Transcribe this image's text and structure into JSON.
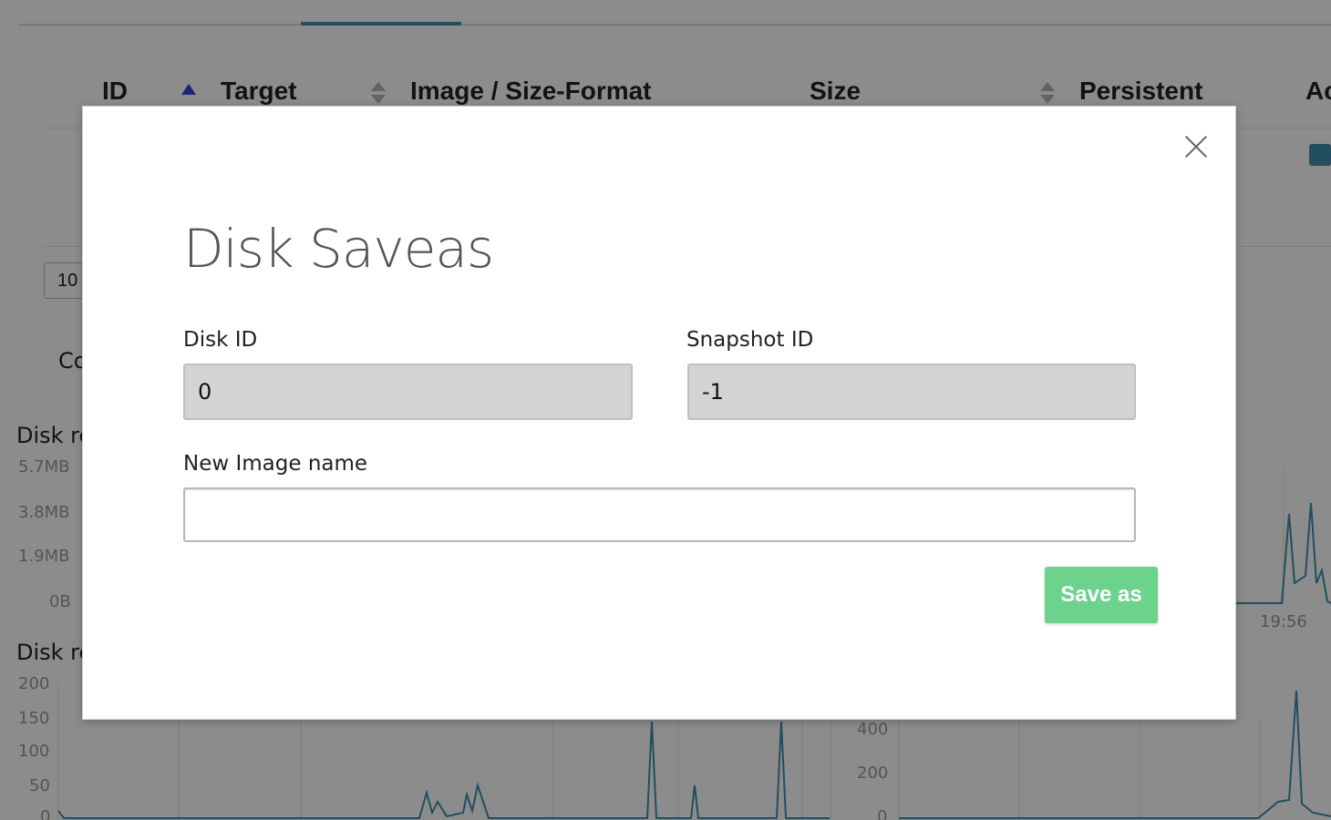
{
  "table": {
    "columns": [
      {
        "label": "ID"
      },
      {
        "label": "Target"
      },
      {
        "label": "Image / Size-Format"
      },
      {
        "label": "Size"
      },
      {
        "label": "Persistent"
      },
      {
        "label": "Ac"
      }
    ]
  },
  "pagination": {
    "page_size": "10"
  },
  "background_labels": {
    "conf": "Co",
    "disk_read_bytes": "Disk re",
    "disk_read_iops": "Disk re"
  },
  "charts": {
    "bytes_axis": [
      "5.7MB",
      "3.8MB",
      "1.9MB",
      "0B"
    ],
    "bytes_time_tick": "19:56",
    "iops_axis_left": [
      "200",
      "150",
      "100",
      "50",
      "0"
    ],
    "iops_axis_right": [
      "400",
      "200",
      "0"
    ]
  },
  "modal": {
    "title": "Disk Saveas",
    "disk_id_label": "Disk ID",
    "disk_id_value": "0",
    "snapshot_id_label": "Snapshot ID",
    "snapshot_id_value": "-1",
    "new_image_label": "New Image name",
    "new_image_value": "",
    "save_button": "Save as"
  },
  "colors": {
    "accent": "#3f8fb0",
    "save_button": "#6bd38c",
    "readonly_field": "#d4d4d4"
  }
}
